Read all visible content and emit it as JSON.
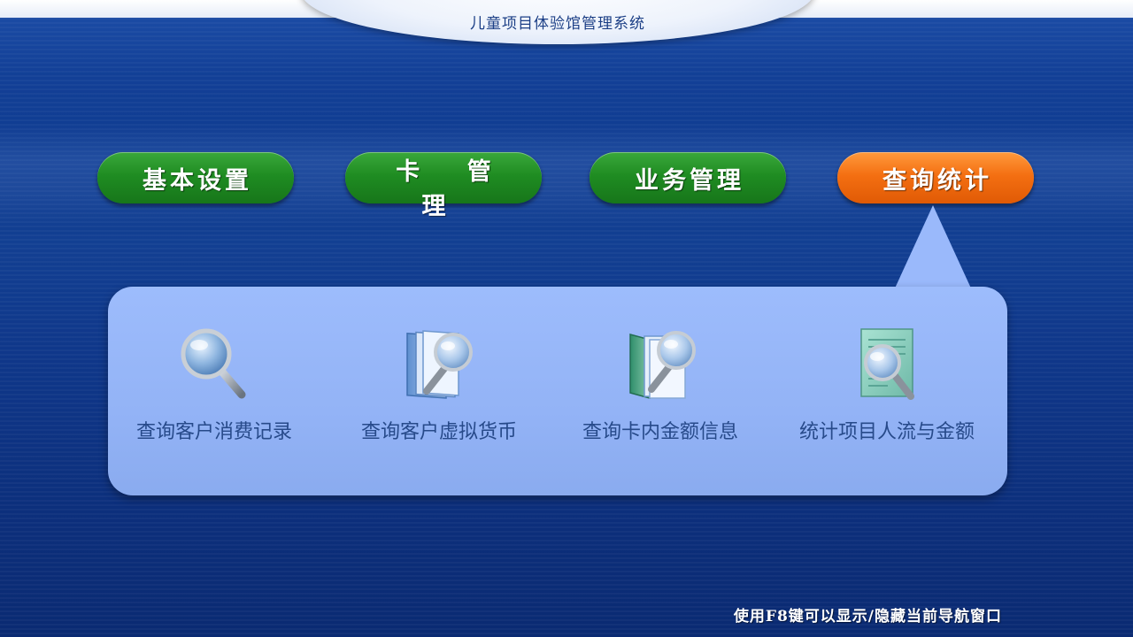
{
  "window": {
    "title": "儿童项目体验馆管理系统"
  },
  "nav": {
    "items": [
      {
        "label": "基本设置",
        "state": "inactive",
        "color": "#1f8c22"
      },
      {
        "label": "卡 管 理",
        "state": "inactive",
        "color": "#1f8c22"
      },
      {
        "label": "业务管理",
        "state": "inactive",
        "color": "#1f8c22"
      },
      {
        "label": "查询统计",
        "state": "active",
        "color": "#f46f12"
      }
    ]
  },
  "panel": {
    "items": [
      {
        "label": "查询客户消费记录",
        "icon": "magnifier-icon"
      },
      {
        "label": "查询客户虚拟货币",
        "icon": "documents-search-icon"
      },
      {
        "label": "查询卡内金额信息",
        "icon": "folder-search-icon"
      },
      {
        "label": "统计项目人流与金额",
        "icon": "document-search-icon"
      }
    ]
  },
  "footer": {
    "hint": "使用F8键可以显示/隐藏当前导航窗口"
  },
  "colors": {
    "background": "#0e3a8e",
    "panel": "#9ab9fb",
    "active_tab": "#f46f12",
    "inactive_tab": "#1f8c22"
  }
}
